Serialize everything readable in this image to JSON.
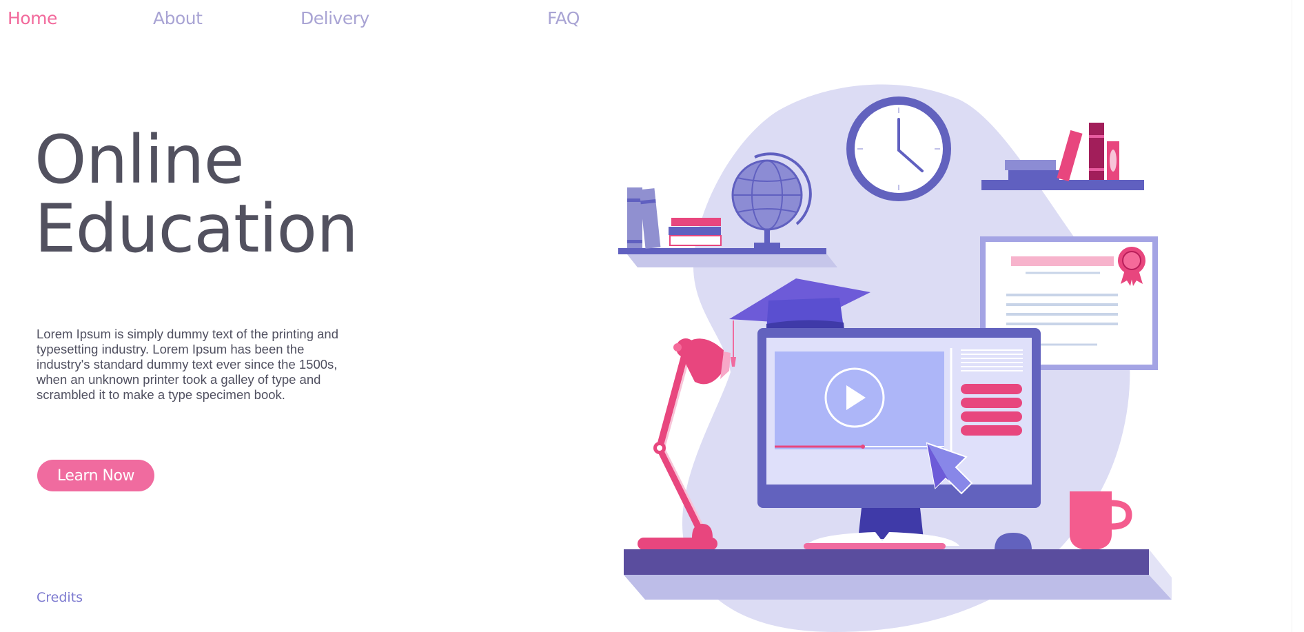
{
  "nav": {
    "home": "Home",
    "about": "About",
    "delivery": "Delivery",
    "faq": "FAQ"
  },
  "hero": {
    "title_line1": "Online",
    "title_line2": "Education",
    "description": "Lorem Ipsum is simply dummy text of the printing and typesetting industry. Lorem Ipsum has been the industry's standard dummy text ever since the 1500s, when an unknown printer took a galley of type and scrambled it to make a type specimen book.",
    "cta_label": "Learn Now"
  },
  "footer": {
    "credits": "Credits"
  },
  "colors": {
    "accent_pink": "#f06b9f",
    "nav_inactive": "#a9a4d4",
    "title": "#52515f",
    "illustration_blob": "#dcdcf4",
    "illustration_purple": "#6060c0"
  },
  "illustration": {
    "icons": [
      "clock-icon",
      "globe-icon",
      "graduation-cap-icon",
      "desk-lamp-icon",
      "monitor-icon",
      "play-icon",
      "cursor-icon",
      "certificate-icon",
      "mug-icon",
      "mouse-icon",
      "books-icon"
    ]
  }
}
